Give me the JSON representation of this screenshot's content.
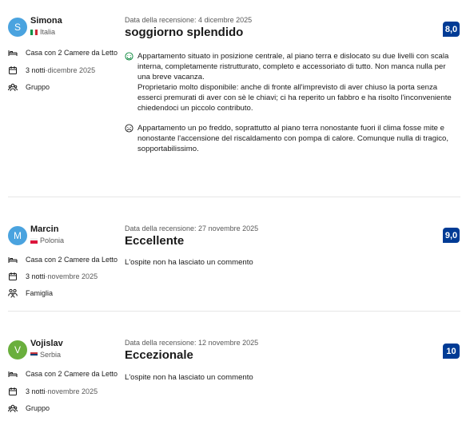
{
  "reviews": [
    {
      "avatar_letter": "S",
      "avatar_color": "#4aa3df",
      "name": "Simona",
      "country": "Italia",
      "room": "Casa con 2 Camere da Letto",
      "nights": "3 notti",
      "stay_month": "dicembre 2025",
      "traveler_type": "Gruppo",
      "date": "Data della recensione: 4 dicembre 2025",
      "title": "soggiorno splendido",
      "score": "8,0",
      "pros": "Appartamento situato in posizione centrale, al piano terra e dislocato su due livelli con scala interna, completamente ristrutturato, completo e accessoriato di tutto. Non manca nulla per una breve vacanza.",
      "pros2": "Proprietario molto disponibile: anche di fronte all'imprevisto di aver chiuso la porta senza esserci premurati di aver con sè le chiavi; ci ha reperito un fabbro e ha risolto l'inconveniente chiedendoci un piccolo contributo.",
      "cons": "Appartamento un po freddo, soprattutto al piano terra nonostante fuori il clima fosse mite e nonostante l'accensione del riscaldamento con pompa di calore. Comunque nulla di tragico, sopportabilissimo."
    },
    {
      "avatar_letter": "M",
      "avatar_color": "#4aa3df",
      "name": "Marcin",
      "country": "Polonia",
      "room": "Casa con 2 Camere da Letto",
      "nights": "3 notti",
      "stay_month": "novembre 2025",
      "traveler_type": "Famiglia",
      "date": "Data della recensione: 27 novembre 2025",
      "title": "Eccellente",
      "score": "9,0",
      "no_comment": "L'ospite non ha lasciato un commento"
    },
    {
      "avatar_letter": "V",
      "avatar_color": "#6aaf3d",
      "name": "Vojislav",
      "country": "Serbia",
      "room": "Casa con 2 Camere da Letto",
      "nights": "3 notti",
      "stay_month": "novembre 2025",
      "traveler_type": "Gruppo",
      "date": "Data della recensione: 12 novembre 2025",
      "title": "Eccezionale",
      "score": "10",
      "no_comment": "L'ospite non ha lasciato un commento"
    }
  ],
  "separator": " · ",
  "colors": {
    "score_bg": "#003b95",
    "muted": "#595959",
    "divider": "#e7e7e7"
  }
}
